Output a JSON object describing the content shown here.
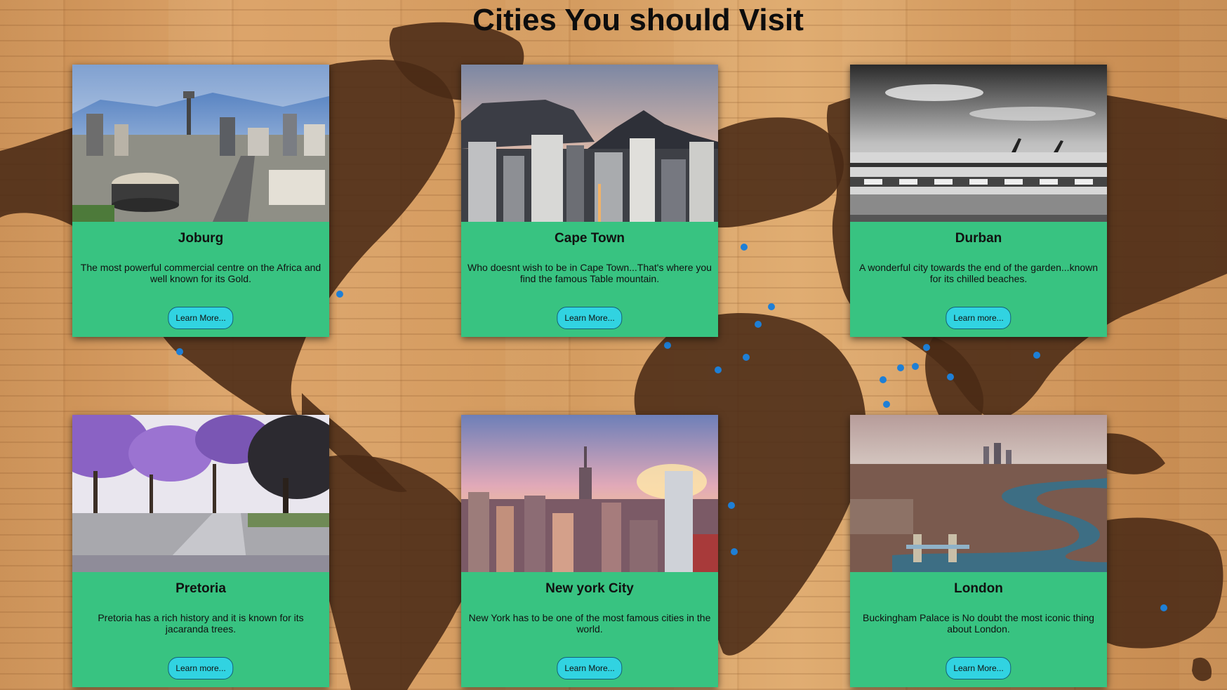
{
  "page": {
    "title": "Cities You should Visit"
  },
  "cards": [
    {
      "title": "Joburg",
      "description": "The most powerful commercial centre on the Africa and well known for its Gold.",
      "button": "Learn More...",
      "image": "johannesburg-skyline-photo"
    },
    {
      "title": "Cape Town",
      "description": "Who doesnt wish to be in Cape Town...That's where you find the famous Table mountain.",
      "button": "Learn More...",
      "image": "cape-town-table-mountain-photo"
    },
    {
      "title": "Durban",
      "description": "A wonderful city towards the end of the garden...known for its chilled beaches.",
      "button": "Learn more...",
      "image": "durban-stadium-bw-photo"
    },
    {
      "title": "Pretoria",
      "description": "Pretoria has a rich history and it is known for its jacaranda trees.",
      "button": "Learn more...",
      "image": "pretoria-jacaranda-photo"
    },
    {
      "title": "New york City",
      "description": "New York has to be one of the most famous cities in the world.",
      "button": "Learn More...",
      "image": "new-york-skyline-photo"
    },
    {
      "title": "London",
      "description": "Buckingham Palace is No doubt the most iconic thing about London.",
      "button": "Learn More...",
      "image": "london-thames-aerial-photo"
    }
  ],
  "colors": {
    "card_background": "#38c381",
    "button_background": "#31d3e1",
    "map_land": "#4a2a16",
    "map_pins": "#1e7fd6"
  }
}
